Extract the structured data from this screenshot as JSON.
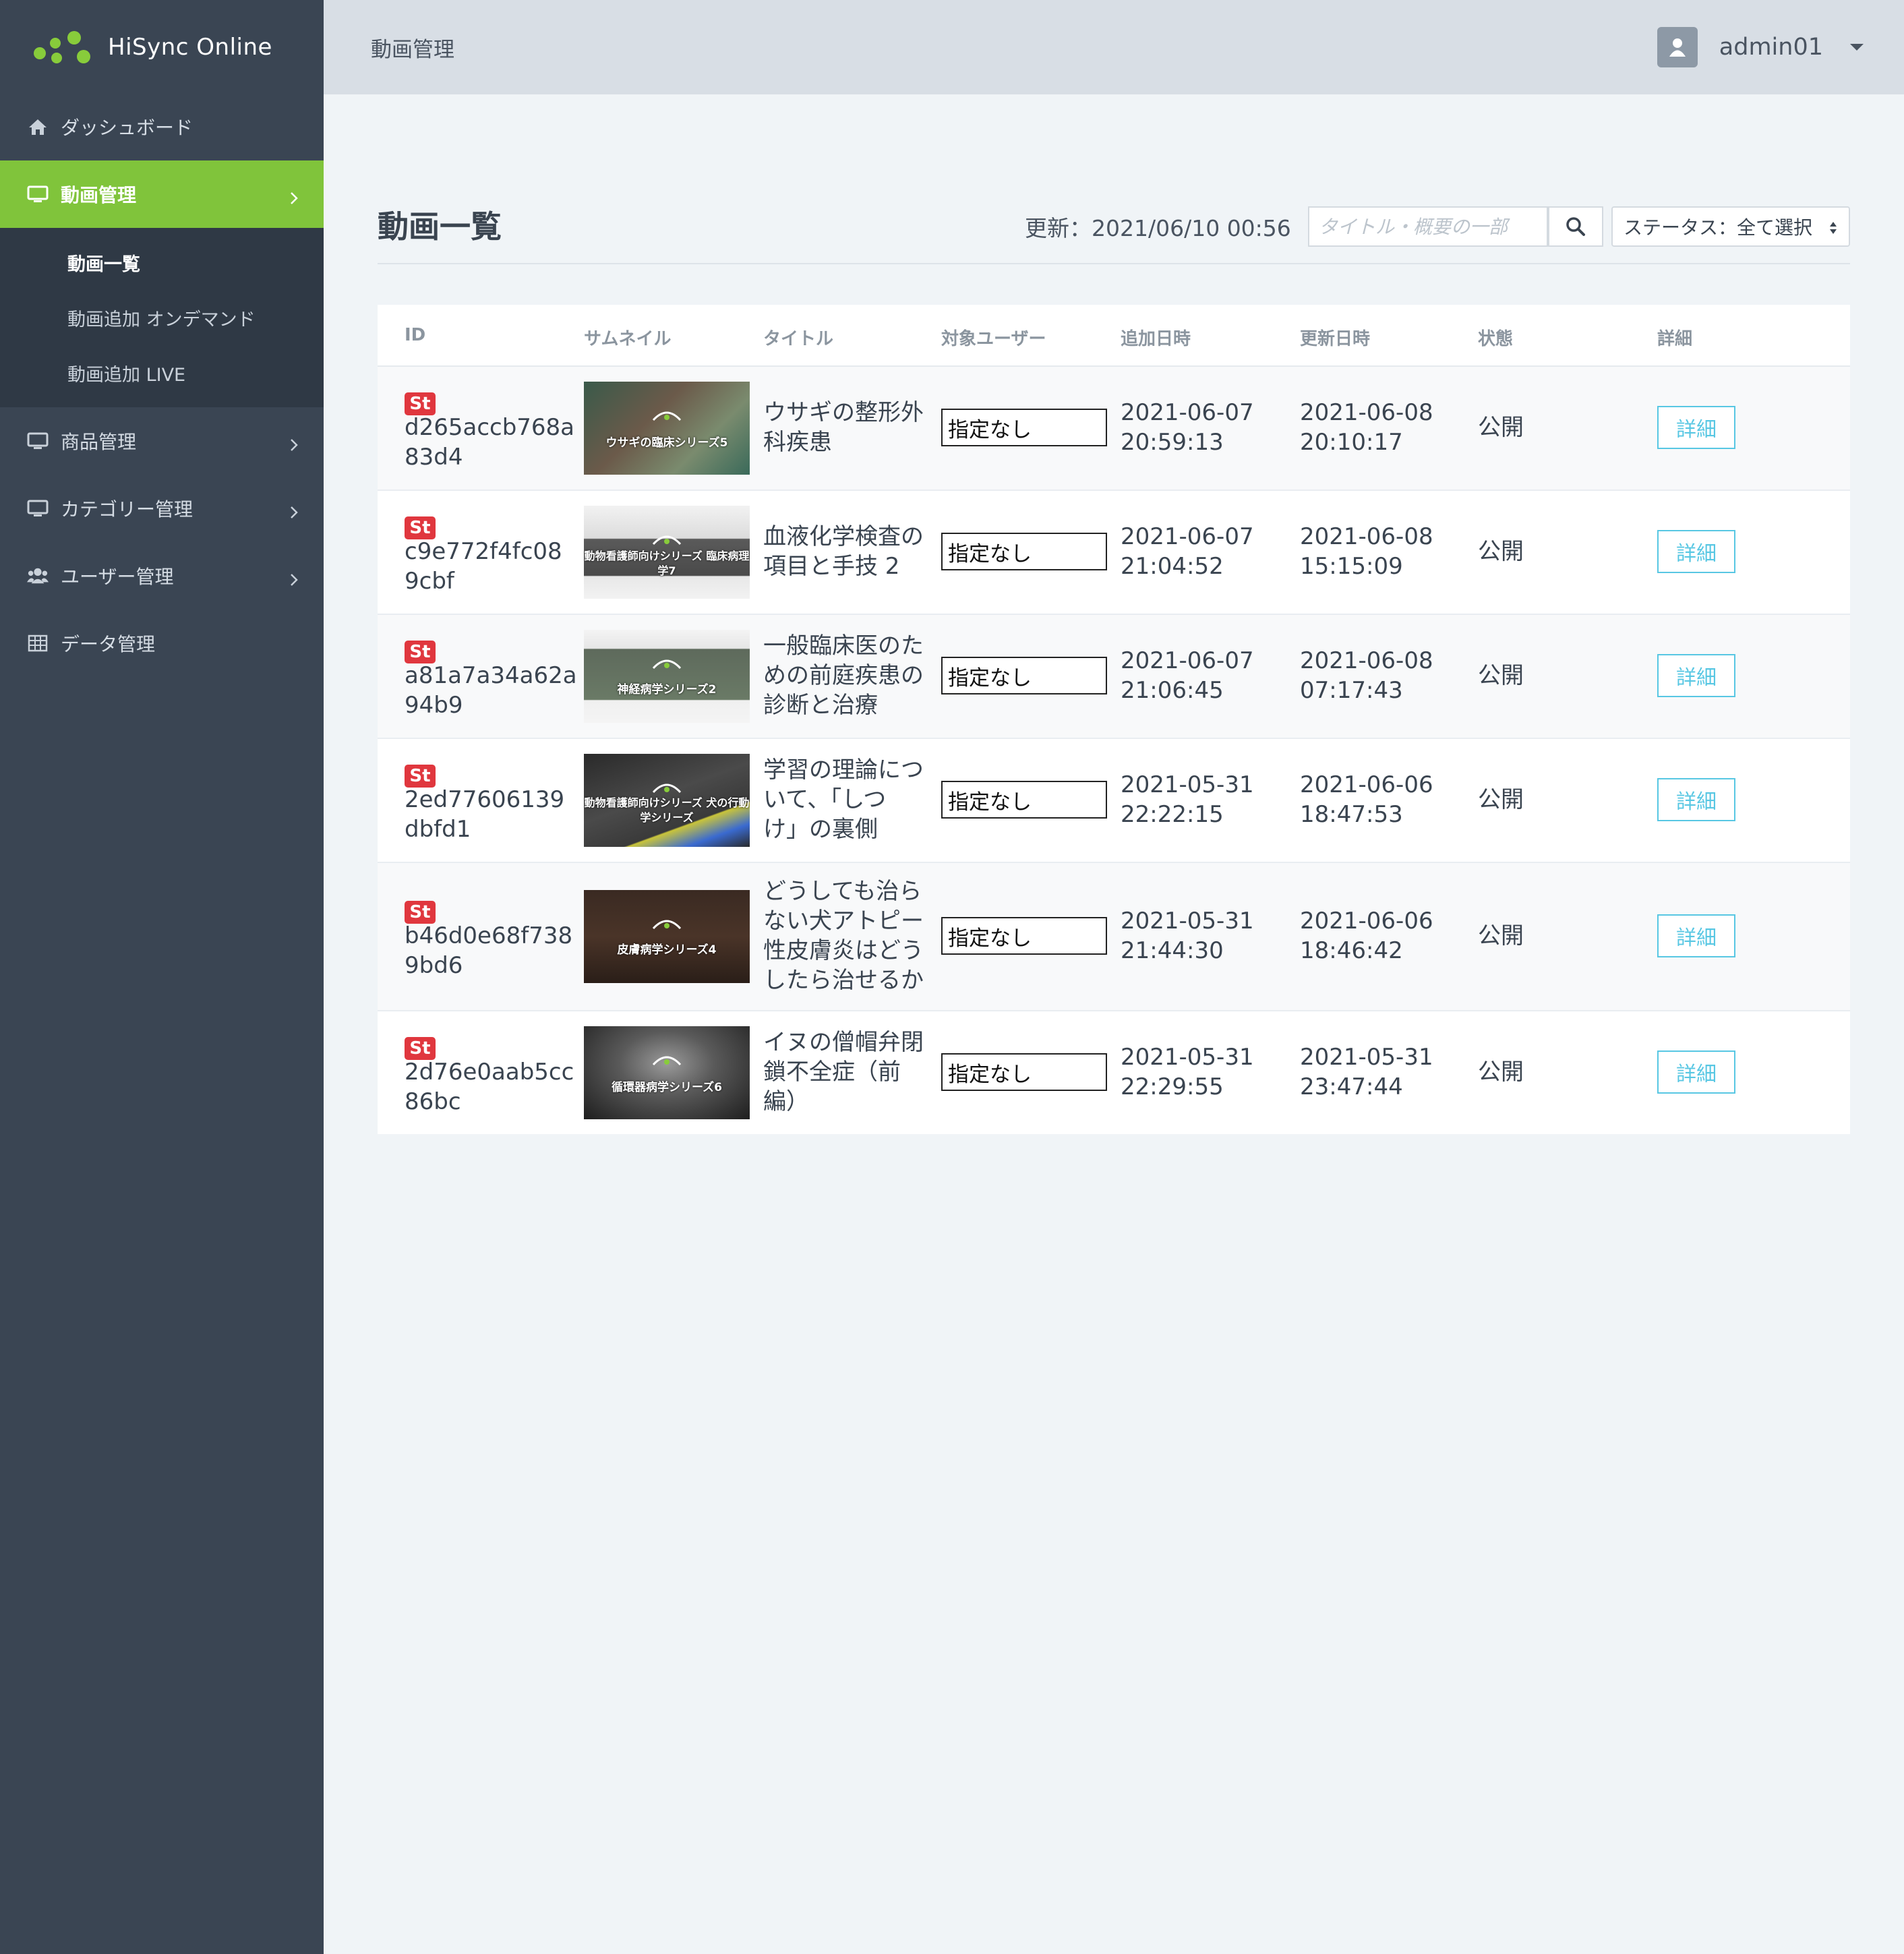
{
  "brand": {
    "name": "HiSync Online",
    "accent": "#80c43b"
  },
  "sidebar": {
    "items": [
      {
        "label": "ダッシュボード",
        "icon": "home-icon"
      },
      {
        "label": "動画管理",
        "icon": "monitor-icon",
        "active": true,
        "children": [
          {
            "label": "動画一覧",
            "active": true
          },
          {
            "label": "動画追加 オンデマンド"
          },
          {
            "label": "動画追加 LIVE"
          }
        ]
      },
      {
        "label": "商品管理",
        "icon": "monitor-icon"
      },
      {
        "label": "カテゴリー管理",
        "icon": "monitor-icon"
      },
      {
        "label": "ユーザー管理",
        "icon": "users-icon"
      },
      {
        "label": "データ管理",
        "icon": "table-icon"
      }
    ]
  },
  "header": {
    "breadcrumb": "動画管理",
    "username": "admin01"
  },
  "main": {
    "title": "動画一覧",
    "updated": "更新：2021/06/10 00:56",
    "search_placeholder": "タイトル・概要の一部",
    "status_filter": "ステータス：全て選択"
  },
  "table": {
    "columns": [
      "ID",
      "サムネイル",
      "タイトル",
      "対象ユーザー",
      "追加日時",
      "更新日時",
      "状態",
      "詳細"
    ],
    "rows": [
      {
        "badge": "St",
        "id_line1": "d265accb768a",
        "id_line2": "83d4",
        "thumb_label": "ウサギの臨床シリーズ5",
        "title_lines": [
          "ウサギの整形外",
          "科疾患"
        ],
        "target_user": "指定なし",
        "added_date": "2021-06-07",
        "added_time": "20:59:13",
        "updated_date": "2021-06-08",
        "updated_time": "20:10:17",
        "status": "公開",
        "detail": "詳細"
      },
      {
        "badge": "St",
        "id_line1": "c9e772f4fc08",
        "id_line2": "9cbf",
        "thumb_label": "動物看護師向けシリーズ 臨床病理学7",
        "title_lines": [
          "血液化学検査の",
          "項目と手技 2"
        ],
        "target_user": "指定なし",
        "added_date": "2021-06-07",
        "added_time": "21:04:52",
        "updated_date": "2021-06-08",
        "updated_time": "15:15:09",
        "status": "公開",
        "detail": "詳細"
      },
      {
        "badge": "St",
        "id_line1": "a81a7a34a62a",
        "id_line2": "94b9",
        "thumb_label": "神経病学シリーズ2",
        "title_lines": [
          "一般臨床医のた",
          "めの前庭疾患の",
          "診断と治療"
        ],
        "target_user": "指定なし",
        "added_date": "2021-06-07",
        "added_time": "21:06:45",
        "updated_date": "2021-06-08",
        "updated_time": "07:17:43",
        "status": "公開",
        "detail": "詳細"
      },
      {
        "badge": "St",
        "id_line1": "2ed77606139",
        "id_line2": "dbfd1",
        "thumb_label": "動物看護師向けシリーズ 犬の行動学シリーズ",
        "title_lines": [
          "学習の理論につ",
          "いて、「しつ",
          "け」の裏側"
        ],
        "target_user": "指定なし",
        "added_date": "2021-05-31",
        "added_time": "22:22:15",
        "updated_date": "2021-06-06",
        "updated_time": "18:47:53",
        "status": "公開",
        "detail": "詳細"
      },
      {
        "badge": "St",
        "id_line1": "b46d0e68f738",
        "id_line2": "9bd6",
        "thumb_label": "皮膚病学シリーズ4",
        "title_lines": [
          "どうしても治ら",
          "ない犬アトピー",
          "性皮膚炎はどう",
          "したら治せるか"
        ],
        "target_user": "指定なし",
        "added_date": "2021-05-31",
        "added_time": "21:44:30",
        "updated_date": "2021-06-06",
        "updated_time": "18:46:42",
        "status": "公開",
        "detail": "詳細"
      },
      {
        "badge": "St",
        "id_line1": "2d76e0aab5cc",
        "id_line2": "86bc",
        "thumb_label": "循環器病学シリーズ6",
        "title_lines": [
          "イヌの僧帽弁閉",
          "鎖不全症（前",
          "編）"
        ],
        "target_user": "指定なし",
        "added_date": "2021-05-31",
        "added_time": "22:29:55",
        "updated_date": "2021-05-31",
        "updated_time": "23:47:44",
        "status": "公開",
        "detail": "詳細"
      }
    ]
  }
}
